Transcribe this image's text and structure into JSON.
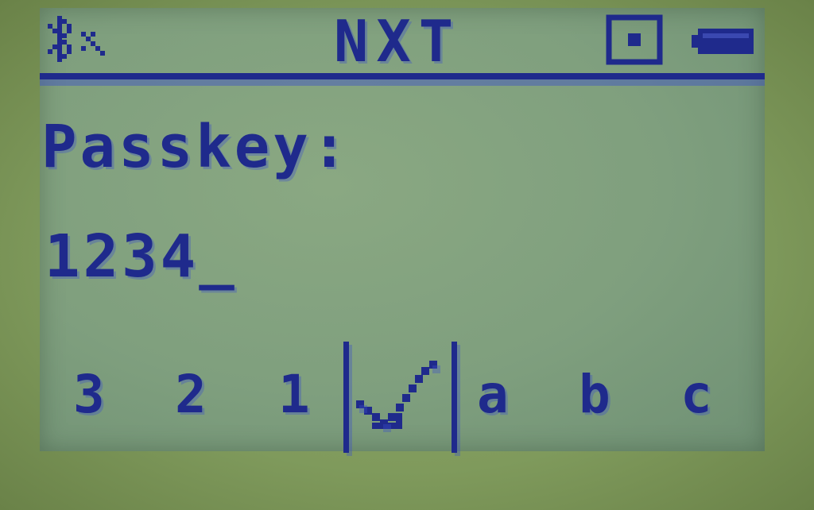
{
  "status_bar": {
    "left_icon": "bluetooth-icon",
    "title": "NXT",
    "usb_icon": "usb-connection-icon",
    "battery_icon": "battery-icon"
  },
  "prompt": {
    "label": "Passkey:",
    "value": "1234_"
  },
  "picker": {
    "left_items": [
      "3",
      "2",
      "1"
    ],
    "selected_icon": "checkmark-icon",
    "right_items": [
      "a",
      "b",
      "c"
    ]
  },
  "colors": {
    "lcd_background": "#7f9f7e",
    "pixel_ink": "#1f2a8c",
    "bezel": "#8fa86a"
  }
}
